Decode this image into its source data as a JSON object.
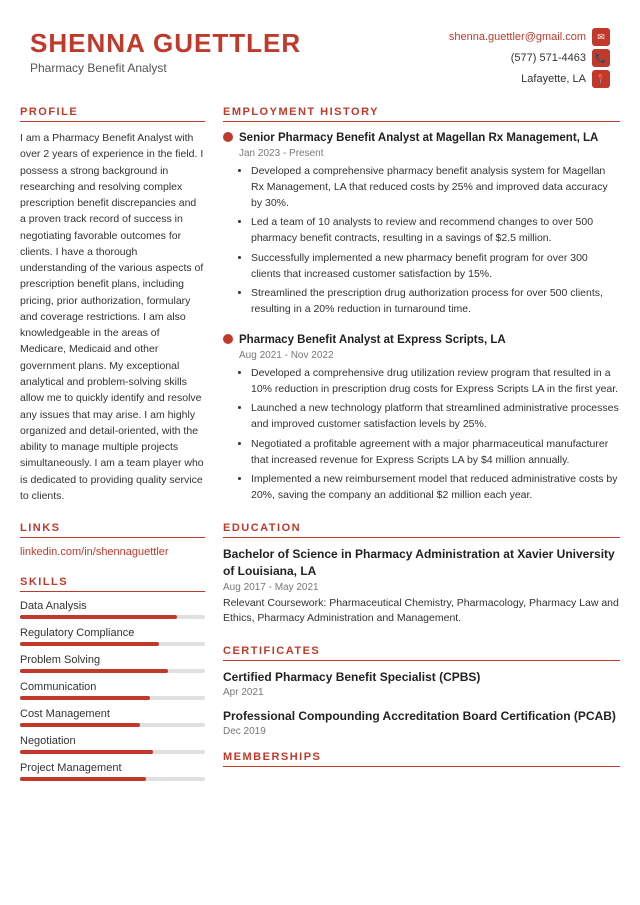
{
  "header": {
    "name": "SHENNA GUETTLER",
    "title": "Pharmacy Benefit Analyst",
    "email": "shenna.guettler@gmail.com",
    "phone": "(577) 571-4463",
    "location": "Lafayette, LA"
  },
  "profile": {
    "section_label": "PROFILE",
    "text": "I am a Pharmacy Benefit Analyst with over 2 years of experience in the field. I possess a strong background in researching and resolving complex prescription benefit discrepancies and a proven track record of success in negotiating favorable outcomes for clients. I have a thorough understanding of the various aspects of prescription benefit plans, including pricing, prior authorization, formulary and coverage restrictions. I am also knowledgeable in the areas of Medicare, Medicaid and other government plans. My exceptional analytical and problem-solving skills allow me to quickly identify and resolve any issues that may arise. I am highly organized and detail-oriented, with the ability to manage multiple projects simultaneously. I am a team player who is dedicated to providing quality service to clients."
  },
  "links": {
    "section_label": "LINKS",
    "linkedin": "linkedin.com/in/shennaguettler"
  },
  "skills": {
    "section_label": "SKILLS",
    "items": [
      {
        "name": "Data Analysis",
        "level": 85
      },
      {
        "name": "Regulatory Compliance",
        "level": 75
      },
      {
        "name": "Problem Solving",
        "level": 80
      },
      {
        "name": "Communication",
        "level": 70
      },
      {
        "name": "Cost Management",
        "level": 65
      },
      {
        "name": "Negotiation",
        "level": 72
      },
      {
        "name": "Project Management",
        "level": 68
      }
    ]
  },
  "employment": {
    "section_label": "EMPLOYMENT HISTORY",
    "jobs": [
      {
        "title": "Senior Pharmacy Benefit Analyst at Magellan Rx Management, LA",
        "dates": "Jan 2023 - Present",
        "bullets": [
          "Developed a comprehensive pharmacy benefit analysis system for Magellan Rx Management, LA that reduced costs by 25% and improved data accuracy by 30%.",
          "Led a team of 10 analysts to review and recommend changes to over 500 pharmacy benefit contracts, resulting in a savings of $2.5 million.",
          "Successfully implemented a new pharmacy benefit program for over 300 clients that increased customer satisfaction by 15%.",
          "Streamlined the prescription drug authorization process for over 500 clients, resulting in a 20% reduction in turnaround time."
        ]
      },
      {
        "title": "Pharmacy Benefit Analyst at Express Scripts, LA",
        "dates": "Aug 2021 - Nov 2022",
        "bullets": [
          "Developed a comprehensive drug utilization review program that resulted in a 10% reduction in prescription drug costs for Express Scripts LA in the first year.",
          "Launched a new technology platform that streamlined administrative processes and improved customer satisfaction levels by 25%.",
          "Negotiated a profitable agreement with a major pharmaceutical manufacturer that increased revenue for Express Scripts LA by $4 million annually.",
          "Implemented a new reimbursement model that reduced administrative costs by 20%, saving the company an additional $2 million each year."
        ]
      }
    ]
  },
  "education": {
    "section_label": "EDUCATION",
    "entries": [
      {
        "title": "Bachelor of Science in Pharmacy Administration at Xavier University of Louisiana, LA",
        "dates": "Aug 2017 - May 2021",
        "coursework": "Relevant Coursework: Pharmaceutical Chemistry, Pharmacology, Pharmacy Law and Ethics, Pharmacy Administration and Management."
      }
    ]
  },
  "certificates": {
    "section_label": "CERTIFICATES",
    "entries": [
      {
        "title": "Certified Pharmacy Benefit Specialist (CPBS)",
        "date": "Apr 2021"
      },
      {
        "title": "Professional Compounding Accreditation Board Certification (PCAB)",
        "date": "Dec 2019"
      }
    ]
  },
  "memberships": {
    "section_label": "MEMBERSHIPS"
  }
}
